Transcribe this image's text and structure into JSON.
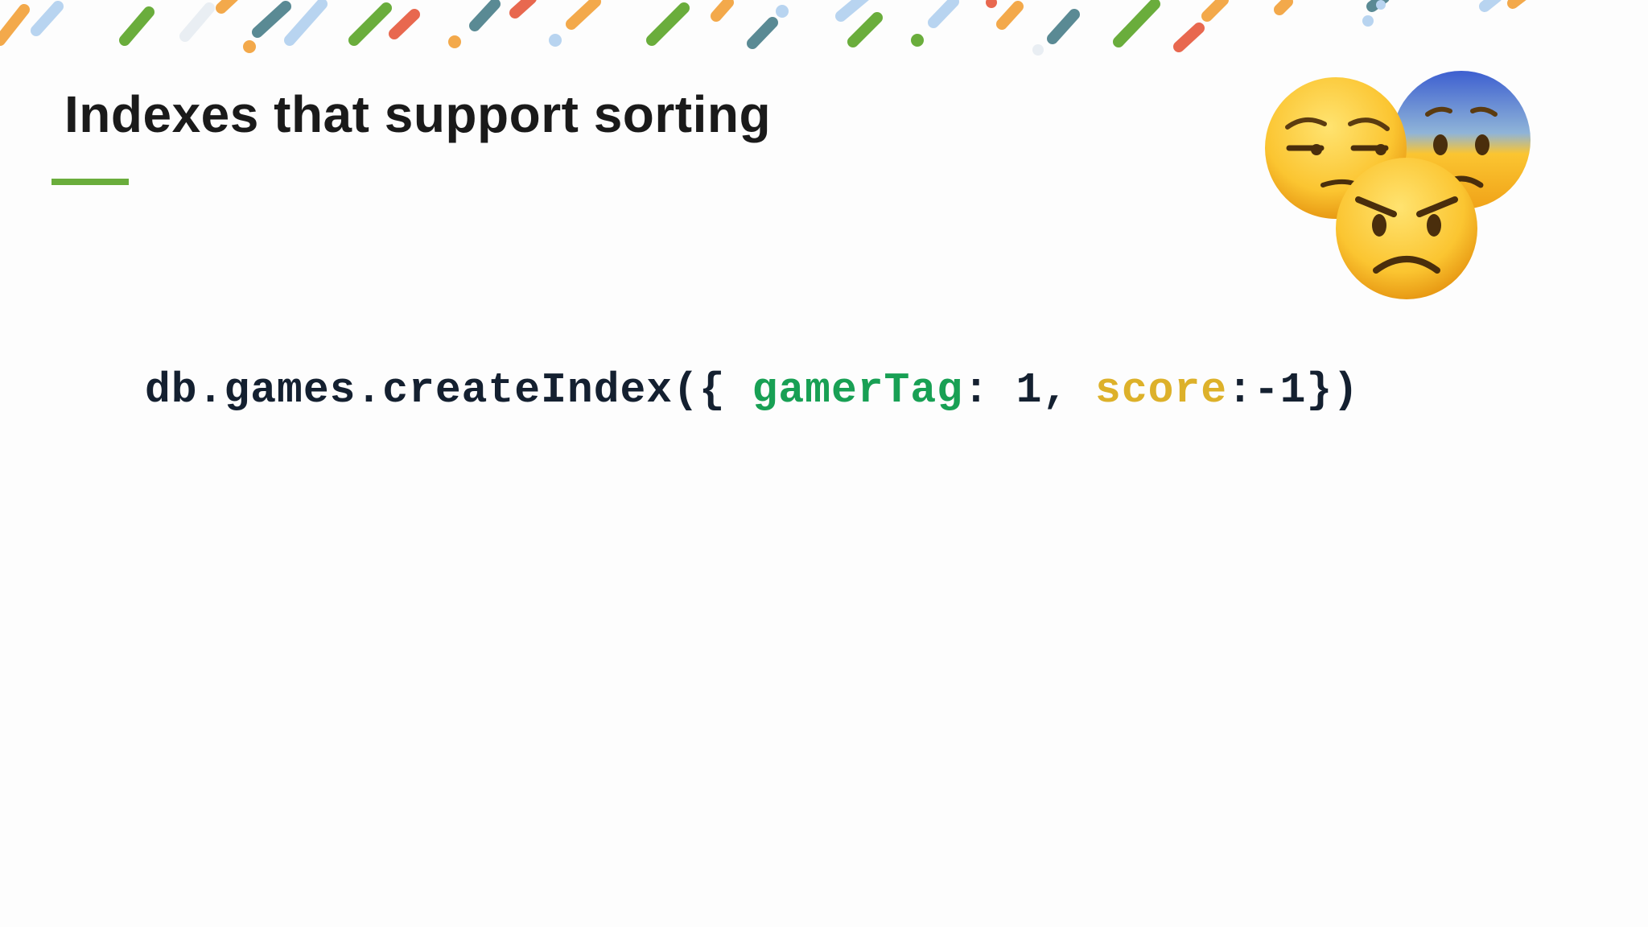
{
  "slide": {
    "title": "Indexes that support sorting",
    "accent_color": "#6aad3c"
  },
  "code": {
    "prefix": "db.games.createIndex({ ",
    "key1": "gamerTag",
    "between": ": 1, ",
    "key2": "score",
    "suffix": ":-1})",
    "colors": {
      "text": "#142030",
      "key1": "#18a054",
      "key2": "#ddb12a"
    }
  },
  "decoration": {
    "confetti_colors": [
      "#f3a94b",
      "#6aad3c",
      "#5a8a94",
      "#e8684f",
      "#b8d4f0"
    ],
    "emojis": [
      "unamused-face-icon",
      "anxious-face-with-sweat-icon",
      "angry-face-icon"
    ]
  }
}
